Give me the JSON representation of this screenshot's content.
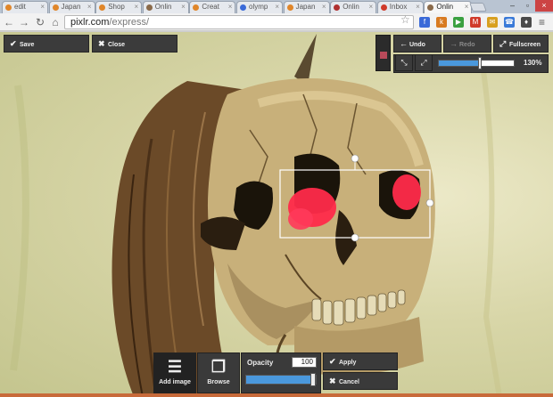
{
  "browser": {
    "tabs": [
      {
        "label": "edit",
        "favicon": "#e0862a"
      },
      {
        "label": "Japan",
        "favicon": "#e0862a"
      },
      {
        "label": "Shop",
        "favicon": "#e0862a"
      },
      {
        "label": "Onlin",
        "favicon": "#8a6a4a"
      },
      {
        "label": "Creat",
        "favicon": "#e0862a"
      },
      {
        "label": "olymp",
        "favicon": "#3a6ad8"
      },
      {
        "label": "Japan",
        "favicon": "#e0862a"
      },
      {
        "label": "Onlin",
        "favicon": "#b03030"
      },
      {
        "label": "Inbox",
        "favicon": "#d03a2a"
      },
      {
        "label": "Onlin",
        "favicon": "#8a6a4a"
      }
    ],
    "tab_close_glyph": "×",
    "url_host": "pixlr.com",
    "url_path": "/express/",
    "extensions": [
      {
        "glyph": "f",
        "color": "#3a6ad8"
      },
      {
        "glyph": "k",
        "color": "#d87a20"
      },
      {
        "glyph": "▶",
        "color": "#3aa040"
      },
      {
        "glyph": "M",
        "color": "#d03a2a"
      },
      {
        "glyph": "✉",
        "color": "#d8a020"
      },
      {
        "glyph": "☎",
        "color": "#3a7ad8"
      },
      {
        "glyph": "♦",
        "color": "#4a4a4a"
      }
    ]
  },
  "editor": {
    "save_label": "Save",
    "close_label": "Close",
    "undo_label": "Undo",
    "redo_label": "Redo",
    "fullscreen_label": "Fullscreen",
    "zoom_value": "130%",
    "zoom_fraction": 0.55,
    "add_image_label": "Add image",
    "browse_label": "Browse",
    "opacity_label": "Opacity",
    "opacity_value": "100",
    "opacity_fraction": 1.0,
    "apply_label": "Apply",
    "cancel_label": "Cancel",
    "colors": {
      "panel": "#3a3a3a",
      "accent": "#4a98dc",
      "red_eye": "#ff2a4a"
    }
  }
}
